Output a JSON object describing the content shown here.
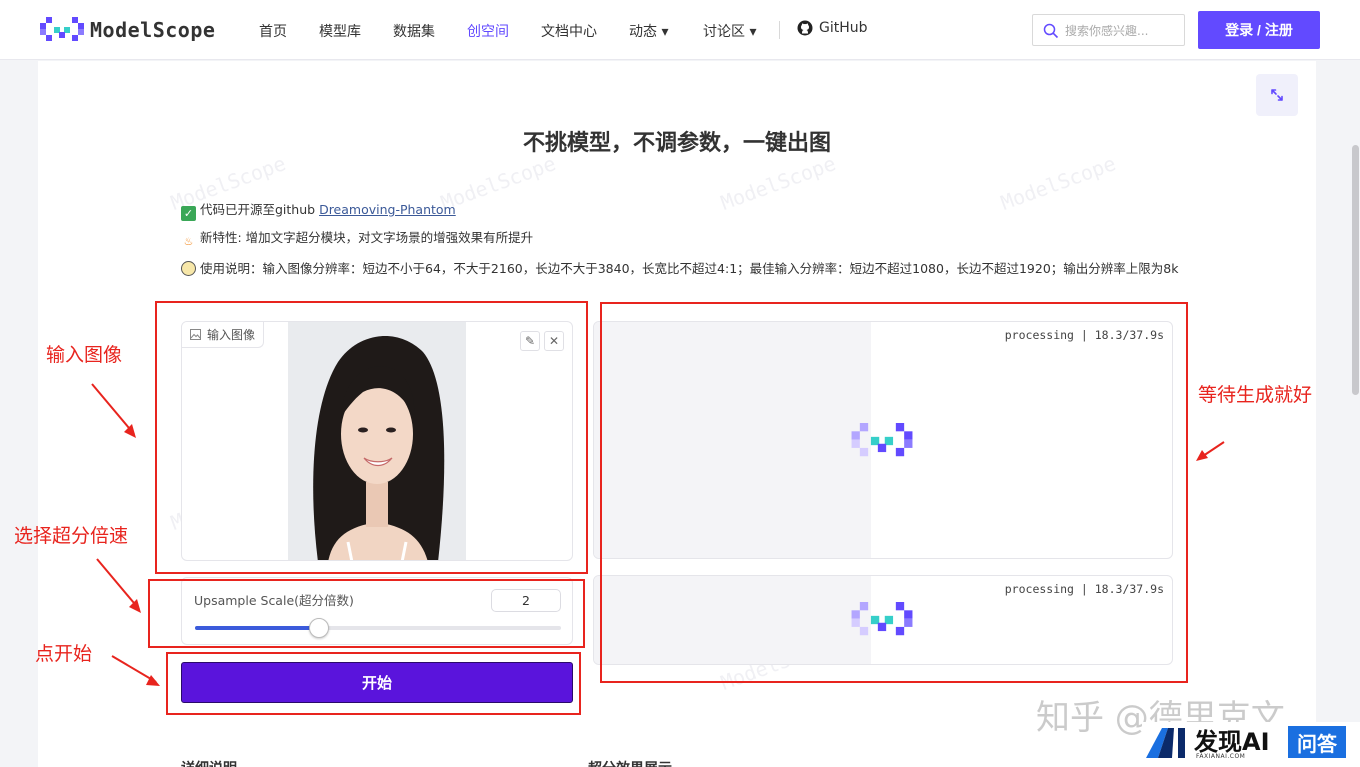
{
  "nav": {
    "logo_text": "ModelScope",
    "items": [
      "首页",
      "模型库",
      "数据集",
      "创空间",
      "文档中心",
      "动态 ▾",
      "讨论区 ▾"
    ],
    "github": "GitHub",
    "search_placeholder": "搜索你感兴趣...",
    "login": "登录 / 注册",
    "active_item": "创空间"
  },
  "page": {
    "headline": "不挑模型，不调参数，一键出图",
    "info1_prefix": "代码已开源至github ",
    "info1_link": "Dreamoving-Phantom",
    "info2": "新特性: 增加文字超分模块，对文字场景的增强效果有所提升",
    "info3": "使用说明：输入图像分辨率：短边不小于64，不大于2160，长边不大于3840，长宽比不超过4:1；最佳输入分辨率：短边不超过1080，长边不超过1920；输出分辨率上限为8k",
    "watermark": "ModelScope"
  },
  "input_card": {
    "label": "输入图像"
  },
  "slider": {
    "label": "Upsample Scale(超分倍数)",
    "value": "2",
    "fill_fraction": 0.34
  },
  "start_button": "开始",
  "outputs": [
    {
      "status": "processing | 18.3/37.9s"
    },
    {
      "status": "processing | 18.3/37.9s"
    }
  ],
  "bottom": {
    "left": "详细说明",
    "right": "超分效果展示"
  },
  "annotations": {
    "input_image": "输入图像",
    "choose_scale": "选择超分倍速",
    "click_start": "点开始",
    "wait": "等待生成就好"
  },
  "overlay": {
    "zhihu": "知乎 @德里克文",
    "faxian": "发现AI",
    "faxian_sub": "FAXIANAI.COM",
    "badge": "问答"
  },
  "colors": {
    "brand": "#624aff",
    "start_button": "#5a14dc",
    "annotation": "#e8241e"
  }
}
